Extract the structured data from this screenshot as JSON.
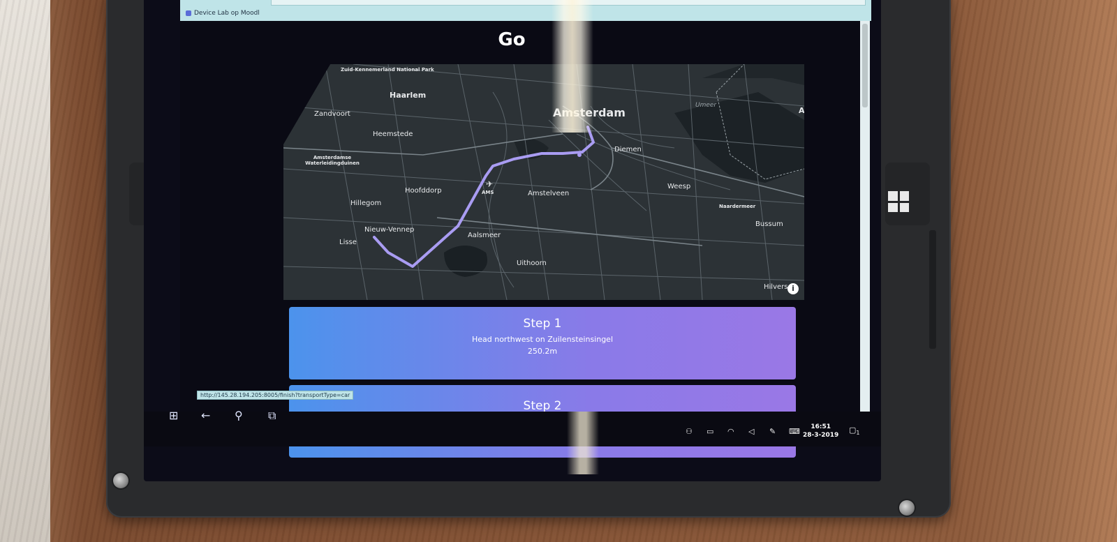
{
  "browser": {
    "tab_title": "Device Lab op Moodl",
    "status_url": "http://145.28.194.205:8005/finish?transportType=car"
  },
  "page": {
    "title": "Go"
  },
  "map": {
    "labels": {
      "zuid_kennemerland": "Zuid-Kennemerland National Park",
      "haarlem": "Haarlem",
      "zandvoort": "Zandvoort",
      "heemstede": "Heemstede",
      "amsterdamse_waterleidingduinen": "Amsterdamse Waterleidingduinen",
      "amsterdam": "Amsterdam",
      "diemen": "Diemen",
      "hoofddorp": "Hoofddorp",
      "ams": "AMS",
      "amstelveen": "Amstelveen",
      "weesp": "Weesp",
      "hillegom": "Hillegom",
      "naardermeer": "Naardermeer",
      "nieuw_vennep": "Nieuw-Vennep",
      "aalsmeer": "Aalsmeer",
      "bussum": "Bussum",
      "lisse": "Lisse",
      "uithoorn": "Uithoorn",
      "hilversum": "Hilvers",
      "umeer": "Umeer",
      "edge_a": "A"
    },
    "info_symbol": "i",
    "route_color": "#a99cf2"
  },
  "steps": [
    {
      "title": "Step 1",
      "instruction": "Head northwest on Zuilensteinsingel",
      "distance": "250.2m"
    },
    {
      "title": "Step 2",
      "instruction": "",
      "distance": ""
    }
  ],
  "taskbar": {
    "clock_time": "16:51",
    "clock_date": "28-3-2019",
    "notification_count": "1",
    "icons": [
      "windows-start-icon",
      "back-arrow-icon",
      "search-icon",
      "task-view-icon"
    ],
    "tray_icons": [
      "people-icon",
      "tablet-icon",
      "wifi-icon",
      "volume-icon",
      "pen-icon",
      "keyboard-icon",
      "notification-icon"
    ]
  }
}
